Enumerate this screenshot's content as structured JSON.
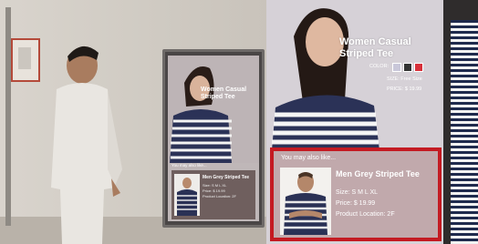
{
  "large_display": {
    "product_title": "Women Casual Striped Tee",
    "color_label": "COLOR:",
    "size_line": "SIZE: Free Size",
    "price_line": "PRICE: $ 19.99",
    "swatch_colors": [
      "#c9c7d9",
      "#333333",
      "#d7303a"
    ]
  },
  "recommendation": {
    "heading": "You may also like...",
    "name": "Men Grey Striped Tee",
    "size": "Size: S M L XL",
    "price": "Price: $ 19.99",
    "location": "Product Location: 2F",
    "border_color": "#c41a22"
  },
  "small_display": {
    "product_title": "Women Casual Striped Tee",
    "heading": "You may also like...",
    "name": "Men Grey Striped Tee",
    "size": "Size: S M L XL",
    "price": "Price: $ 19.99",
    "location": "Product Location: 2F"
  }
}
